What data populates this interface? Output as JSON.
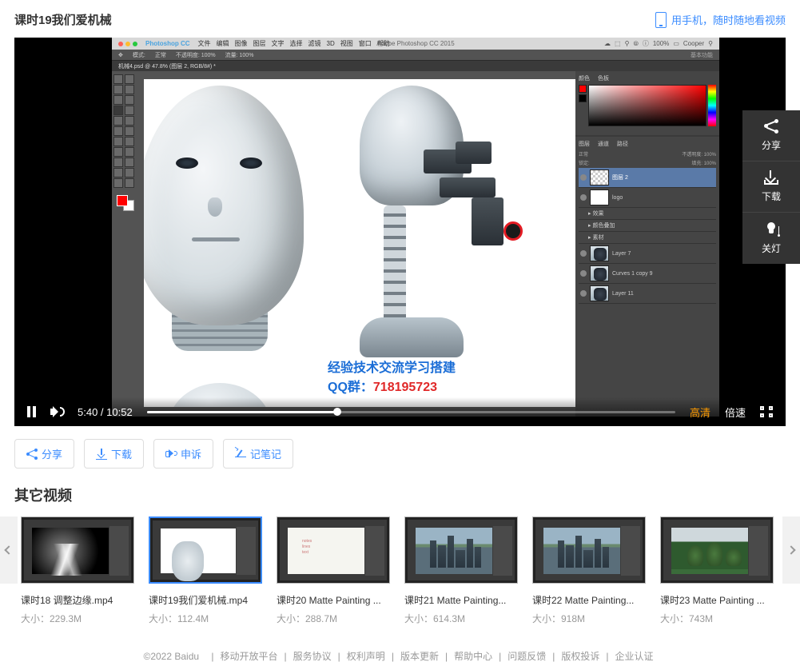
{
  "header": {
    "title": "课时19我们爱机械",
    "mobile_link": "用手机，随时随地看视频"
  },
  "photoshop": {
    "app_name": "Photoshop CC",
    "menu": [
      "文件",
      "编辑",
      "图像",
      "图层",
      "文字",
      "选择",
      "滤镜",
      "3D",
      "视图",
      "窗口",
      "帮助"
    ],
    "window_title": "Adobe Photoshop CC 2015",
    "zoom_label": "100%",
    "user": "Cooper",
    "workspace": "基本功能",
    "option_bar": {
      "mode": "模式:",
      "mode_val": "正常",
      "opacity": "不透明度: 100%",
      "flow": "流量: 100%"
    },
    "doc_tab": "机械4.psd @ 47.8% (图层 2, RGB/8#) *",
    "panels": {
      "color_tab": "颜色",
      "swatch_tab": "色板",
      "layers_tab": "图层",
      "channels_tab": "通道",
      "paths_tab": "路径",
      "blend_mode": "正常",
      "layer_opacity": "不透明度: 100%",
      "lock_label": "锁定:",
      "fill_label": "填充: 100%",
      "layers": [
        {
          "name": "图层 2",
          "thumb": "checker",
          "sel": true
        },
        {
          "name": "logo",
          "thumb": "white"
        },
        {
          "name": "效果",
          "group": true
        },
        {
          "name": "颜色叠加",
          "group": true
        },
        {
          "name": "素材",
          "group": true
        },
        {
          "name": "Layer 7",
          "thumb": "robot"
        },
        {
          "name": "Curves 1 copy 9",
          "thumb": "robot"
        },
        {
          "name": "Layer 11",
          "thumb": "robot"
        }
      ]
    },
    "watermark": {
      "line1": "经验技术交流学习搭建",
      "line2_label": "QQ群：",
      "line2_num": "718195723"
    }
  },
  "player": {
    "current": "5:40",
    "duration": "10:52",
    "quality": "高清",
    "speed": "倍速"
  },
  "sidebar": {
    "share": "分享",
    "download": "下载",
    "lights": "关灯"
  },
  "actions": {
    "share": "分享",
    "download": "下载",
    "report": "申诉",
    "note": "记笔记"
  },
  "other_videos": {
    "title": "其它视频",
    "size_label": "大小：",
    "items": [
      {
        "title": "课时18 调整边缘.mp4",
        "size": "229.3M",
        "thumb": "th0"
      },
      {
        "title": "课时19我们爱机械.mp4",
        "size": "112.4M",
        "thumb": "th1",
        "active": true
      },
      {
        "title": "课时20 Matte Painting ...",
        "size": "288.7M",
        "thumb": "th2"
      },
      {
        "title": "课时21 Matte Painting...",
        "size": "614.3M",
        "thumb": "th-city"
      },
      {
        "title": "课时22 Matte Painting...",
        "size": "918M",
        "thumb": "th-city"
      },
      {
        "title": "课时23 Matte Painting ...",
        "size": "743M",
        "thumb": "th5"
      }
    ]
  },
  "footer": {
    "copyright": "©2022 Baidu",
    "links": [
      "移动开放平台",
      "服务协议",
      "权利声明",
      "版本更新",
      "帮助中心",
      "问题反馈",
      "版权投诉",
      "企业认证"
    ]
  }
}
